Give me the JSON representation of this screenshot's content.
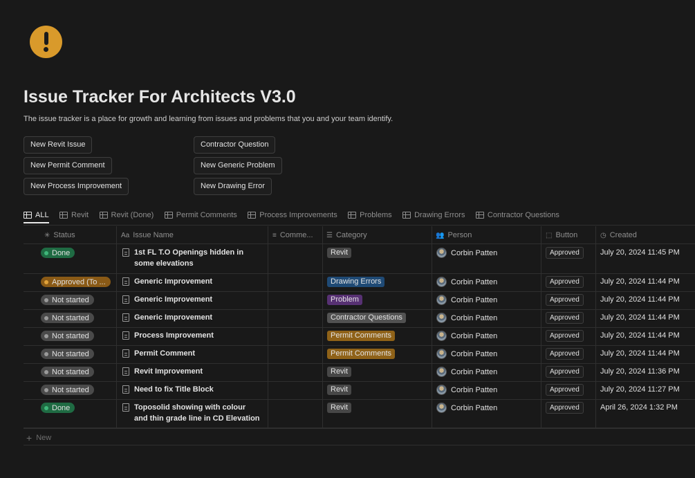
{
  "page": {
    "icon": "exclamation-icon",
    "title": "Issue Tracker For Architects V3.0",
    "description": "The issue tracker is a place for growth and learning from issues and problems that you and your team identify."
  },
  "buttons": [
    "New Revit Issue",
    "New Permit Comment",
    "New Process Improvement",
    "Contractor Question",
    "New Generic Problem",
    "New Drawing Error"
  ],
  "tabs": [
    "ALL",
    "Revit",
    "Revit (Done)",
    "Permit Comments",
    "Process Improvements",
    "Problems",
    "Drawing Errors",
    "Contractor Questions"
  ],
  "columns": {
    "status": "Status",
    "issue_name": "Issue Name",
    "comments": "Comme...",
    "category": "Category",
    "person": "Person",
    "button": "Button",
    "created": "Created"
  },
  "colors": {
    "done": "#1f6b43",
    "approved": "#8a5a16",
    "not_started": "#4a4a4a",
    "revit": "#474747",
    "drawing_errors": "#1f4a75",
    "problem": "#573173",
    "contractor_questions": "#525252",
    "permit_comments": "#8f6218"
  },
  "rows": [
    {
      "status": "Done",
      "name": "1st FL T.O Openings hidden in some elevations",
      "category": "Revit",
      "person": "Corbin Patten",
      "button": "Approved",
      "created": "July 20, 2024 11:45 PM"
    },
    {
      "status": "Approved (To ...",
      "name": "Generic Improvement",
      "category": "Drawing Errors",
      "person": "Corbin Patten",
      "button": "Approved",
      "created": "July 20, 2024 11:44 PM"
    },
    {
      "status": "Not started",
      "name": "Generic Improvement",
      "category": "Problem",
      "person": "Corbin Patten",
      "button": "Approved",
      "created": "July 20, 2024 11:44 PM"
    },
    {
      "status": "Not started",
      "name": "Generic Improvement",
      "category": "Contractor Questions",
      "person": "Corbin Patten",
      "button": "Approved",
      "created": "July 20, 2024 11:44 PM"
    },
    {
      "status": "Not started",
      "name": "Process Improvement",
      "category": "Permit Comments",
      "person": "Corbin Patten",
      "button": "Approved",
      "created": "July 20, 2024 11:44 PM"
    },
    {
      "status": "Not started",
      "name": "Permit Comment",
      "category": "Permit Comments",
      "person": "Corbin Patten",
      "button": "Approved",
      "created": "July 20, 2024 11:44 PM"
    },
    {
      "status": "Not started",
      "name": "Revit Improvement",
      "category": "Revit",
      "person": "Corbin Patten",
      "button": "Approved",
      "created": "July 20, 2024 11:36 PM"
    },
    {
      "status": "Not started",
      "name": "Need to fix Title Block",
      "category": "Revit",
      "person": "Corbin Patten",
      "button": "Approved",
      "created": "July 20, 2024 11:27 PM"
    },
    {
      "status": "Done",
      "name": "Toposolid showing with colour and thin grade line in CD Elevation",
      "category": "Revit",
      "person": "Corbin Patten",
      "button": "Approved",
      "created": "April 26, 2024 1:32 PM"
    }
  ],
  "footer": {
    "new_label": "New"
  }
}
